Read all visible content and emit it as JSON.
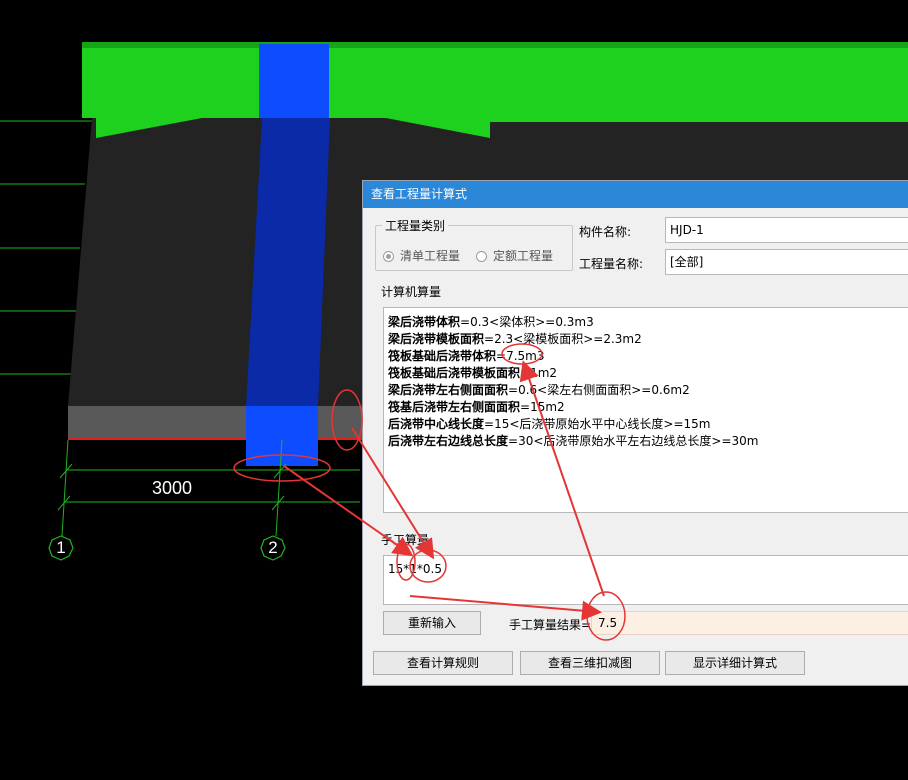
{
  "cad": {
    "dimension": "3000",
    "axes": [
      "1",
      "2"
    ]
  },
  "dialog": {
    "title": "查看工程量计算式",
    "quantity_type": {
      "label": "工程量类别",
      "options": [
        "清单工程量",
        "定额工程量"
      ],
      "selected": "清单工程量"
    },
    "component_name_label": "构件名称:",
    "component_name_value": "HJD-1",
    "quantity_name_label": "工程量名称:",
    "quantity_name_value": "[全部]",
    "computer_calc": {
      "label": "计算机算量",
      "rows": [
        {
          "name": "梁后浇带体积",
          "formula": "=0.3<梁体积>=0.3m3"
        },
        {
          "name": "梁后浇带模板面积",
          "formula": "=2.3<梁模板面积>=2.3m2"
        },
        {
          "name": "筏板基础后浇带体积",
          "formula": "=7.5m3"
        },
        {
          "name": "筏板基础后浇带模板面积",
          "formula": "=1m2"
        },
        {
          "name": "梁后浇带左右侧面面积",
          "formula": "=0.6<梁左右侧面面积>=0.6m2"
        },
        {
          "name": "筏基后浇带左右侧面面积",
          "formula": "=15m2"
        },
        {
          "name": "后浇带中心线长度",
          "formula": "=15<后浇带原始水平中心线长度>=15m"
        },
        {
          "name": "后浇带左右边线总长度",
          "formula": "=30<后浇带原始水平左右边线总长度>=30m"
        }
      ]
    },
    "manual_calc": {
      "label": "手工算量",
      "expression": "15*1*0.5",
      "reenter_button": "重新输入",
      "result_label": "手工算量结果=",
      "result_value": "7.5"
    },
    "buttons": {
      "view_rules": "查看计算规则",
      "view_3d": "查看三维扣减图",
      "show_detail": "显示详细计算式"
    }
  },
  "colors": {
    "beam_green": "#1fd11f",
    "post_blue": "#0b2fd6",
    "slab_dark": "#232323",
    "title_blue": "#2b87d8",
    "annotation_red": "#e53535",
    "grid_green": "#1fb51f"
  }
}
